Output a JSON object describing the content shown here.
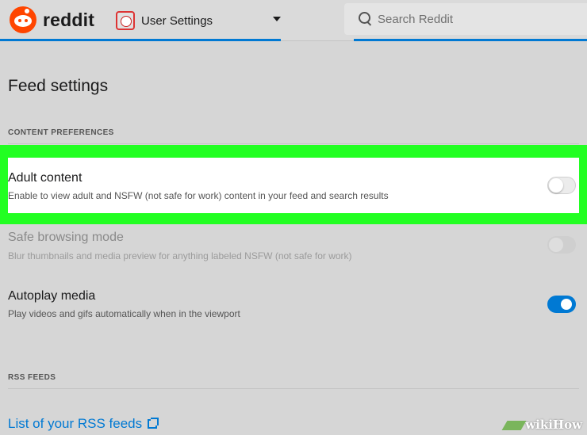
{
  "header": {
    "brand": "reddit",
    "page_selector": "User Settings",
    "search_placeholder": "Search Reddit"
  },
  "page": {
    "title": "Feed settings"
  },
  "content_preferences": {
    "label": "CONTENT PREFERENCES",
    "settings": [
      {
        "title": "Adult content",
        "description": "Enable to view adult and NSFW (not safe for work) content in your feed and search results",
        "enabled": false,
        "highlighted": true
      },
      {
        "title": "Safe browsing mode",
        "description": "Blur thumbnails and media preview for anything labeled NSFW (not safe for work)",
        "enabled": false,
        "disabled": true
      },
      {
        "title": "Autoplay media",
        "description": "Play videos and gifs automatically when in the viewport",
        "enabled": true
      }
    ]
  },
  "rss": {
    "label": "RSS FEEDS",
    "link": "List of your RSS feeds"
  },
  "watermark": "wikiHow",
  "colors": {
    "accent": "#0079d3",
    "brand": "#ff4500",
    "highlight": "#22ff22"
  }
}
